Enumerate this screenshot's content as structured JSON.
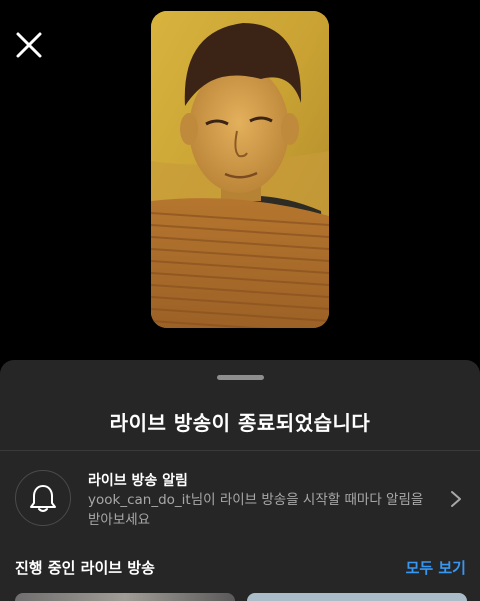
{
  "sheet": {
    "title": "라이브 방송이 종료되었습니다",
    "notification": {
      "title": "라이브 방송 알림",
      "username": "yook_can_do_it",
      "description": "님이 라이브 방송을 시작할 때마다 알림을 받아보세요"
    },
    "section": {
      "title": "진행 중인 라이브 방송",
      "see_all_label": "모두 보기"
    }
  },
  "icons": {
    "close": "close-icon",
    "bell": "bell-icon",
    "chevron": "chevron-right-icon"
  },
  "colors": {
    "background": "#000000",
    "sheet": "#262626",
    "link": "#3897f0",
    "secondary_text": "#a8a8a8"
  }
}
